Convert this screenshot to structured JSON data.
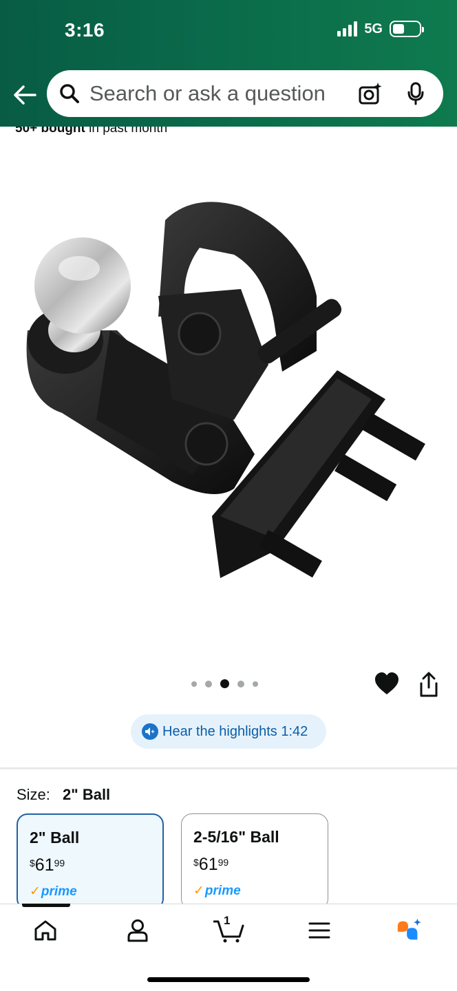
{
  "status_bar": {
    "time": "3:16",
    "network": "5G"
  },
  "search": {
    "placeholder": "Search or ask a question"
  },
  "product": {
    "bought_bold": "50+ bought",
    "bought_rest": " in past month"
  },
  "carousel": {
    "total": 5,
    "active_index": 2
  },
  "highlights": {
    "label": "Hear the highlights 1:42"
  },
  "size": {
    "label": "Size:",
    "selected": "2\" Ball",
    "options": [
      {
        "name": "2\" Ball",
        "currency": "$",
        "whole": "61",
        "fraction": "99",
        "prime": "prime",
        "selected": true
      },
      {
        "name": "2-5/16\" Ball",
        "currency": "$",
        "whole": "61",
        "fraction": "99",
        "prime": "prime",
        "selected": false
      }
    ]
  },
  "nav": {
    "cart_count": "1"
  },
  "colors": {
    "header": "#0a6a4a",
    "accent_blue": "#2162a1",
    "prime_blue": "#1a98ff",
    "prime_orange": "#ff9900"
  }
}
